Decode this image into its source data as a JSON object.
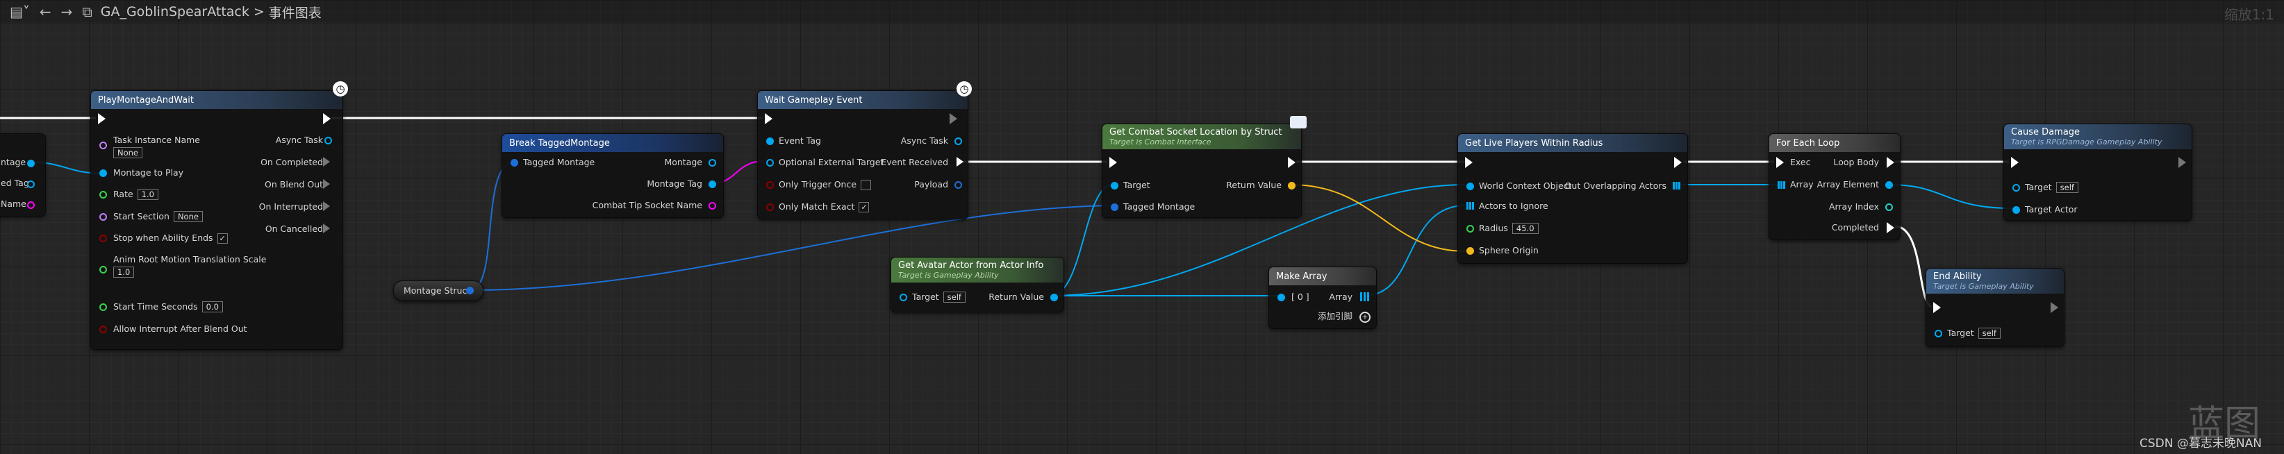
{
  "toolbar": {
    "blueprint_name": "GA_GoblinSpearAttack",
    "separator": ">",
    "graph_name": "事件图表",
    "zoom": "缩放1:1"
  },
  "colors": {
    "exec": "#ffffff",
    "object": "#00a8f0",
    "struct": "#0050d0",
    "string": "#ff40ff",
    "bool": "#8c0000",
    "float": "#38d44f",
    "vector": "#f2b91c",
    "array": "#00a8f0"
  },
  "nodes": {
    "partial_left": {
      "rows": [
        "ntage",
        "ed Tag",
        "Name"
      ]
    },
    "play_montage": {
      "title": "PlayMontageAndWait",
      "task_instance_name": "Task Instance Name",
      "task_instance_value": "None",
      "montage_to_play": "Montage to Play",
      "rate": "Rate",
      "rate_value": "1.0",
      "start_section": "Start Section",
      "start_section_value": "None",
      "stop_when_ends": "Stop when Ability Ends",
      "anim_root": "Anim Root Motion Translation Scale",
      "anim_root_value": "1.0",
      "start_time": "Start Time Seconds",
      "start_time_value": "0.0",
      "allow_interrupt": "Allow Interrupt After Blend Out",
      "async_task": "Async Task",
      "on_completed": "On Completed",
      "on_blend_out": "On Blend Out",
      "on_interrupted": "On Interrupted",
      "on_cancelled": "On Cancelled"
    },
    "break_tagged": {
      "title": "Break TaggedMontage",
      "tagged_montage": "Tagged Montage",
      "montage": "Montage",
      "montage_tag": "Montage Tag",
      "socket_name": "Combat Tip Socket Name"
    },
    "montage_struct": {
      "title": "Montage Struct"
    },
    "wait_event": {
      "title": "Wait Gameplay Event",
      "event_tag": "Event Tag",
      "optional_external": "Optional External Target",
      "only_trigger_once": "Only Trigger Once",
      "only_match_exact": "Only Match Exact",
      "async_task": "Async Task",
      "event_received": "Event Received",
      "payload": "Payload"
    },
    "get_avatar": {
      "title": "Get Avatar Actor from Actor Info",
      "subtitle": "Target is Gameplay Ability",
      "target": "Target",
      "target_value": "self",
      "return_value": "Return Value"
    },
    "get_socket": {
      "title": "Get Combat Socket Location by Struct",
      "subtitle": "Target is Combat Interface",
      "target": "Target",
      "tagged_montage": "Tagged Montage",
      "return_value": "Return Value"
    },
    "make_array": {
      "title": "Make Array",
      "index0": "[ 0 ]",
      "array": "Array",
      "add_pin": "添加引脚"
    },
    "get_live": {
      "title": "Get Live Players Within Radius",
      "world_context": "World Context Object",
      "actors_to_ignore": "Actors to Ignore",
      "radius": "Radius",
      "radius_value": "45.0",
      "sphere_origin": "Sphere Origin",
      "out_overlapping": "Out Overlapping Actors"
    },
    "for_each": {
      "title": "For Each Loop",
      "exec": "Exec",
      "array": "Array",
      "loop_body": "Loop Body",
      "array_element": "Array Element",
      "array_index": "Array Index",
      "completed": "Completed"
    },
    "cause_damage": {
      "title": "Cause Damage",
      "subtitle": "Target is RPGDamage Gameplay Ability",
      "target": "Target",
      "target_value": "self",
      "target_actor": "Target Actor"
    },
    "end_ability": {
      "title": "End Ability",
      "subtitle": "Target is Gameplay Ability",
      "target": "Target",
      "target_value": "self"
    }
  },
  "watermark": "蓝图",
  "credit": "CSDN @暮志未晚NAN"
}
